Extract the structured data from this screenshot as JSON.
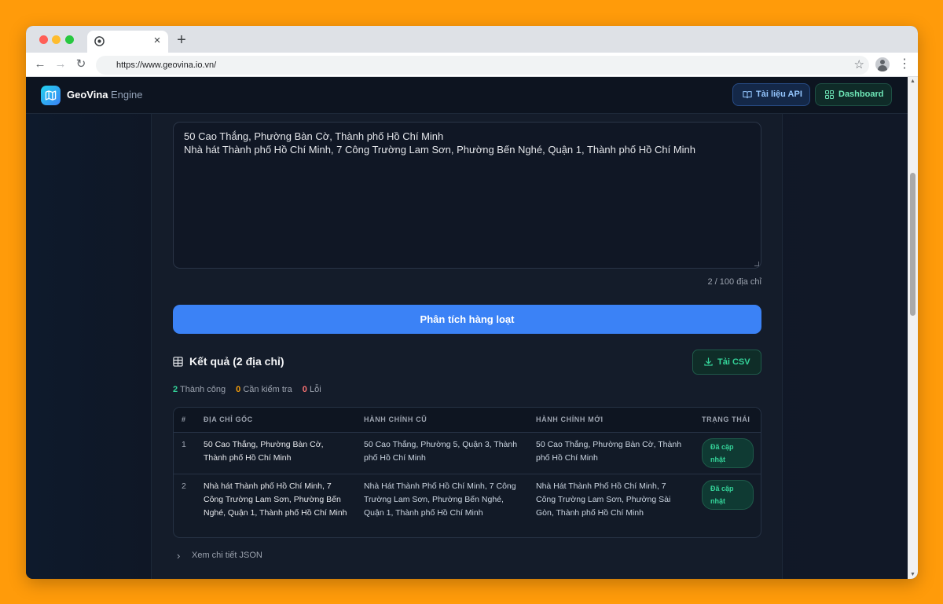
{
  "browser": {
    "url": "https://www.geovina.io.vn/",
    "new_tab": "+",
    "tab_close": "×"
  },
  "header": {
    "brand_name": "GeoVina",
    "brand_suffix": "Engine",
    "api_docs_label": "Tài liệu API",
    "dashboard_label": "Dashboard"
  },
  "input": {
    "lines": [
      "50 Cao Thắng, Phường Bàn Cờ, Thành phố Hồ Chí Minh",
      "Nhà hát Thành phố Hồ Chí Minh, 7 Công Trường Lam Sơn, Phường Bến Nghé, Quận 1, Thành phố Hồ Chí Minh"
    ],
    "counter": "2 / 100 địa chỉ"
  },
  "actions": {
    "analyze_label": "Phân tích hàng loạt",
    "csv_label": "Tải CSV"
  },
  "results": {
    "title": "Kết quả (2 địa chỉ)",
    "stats": {
      "success_count": "2",
      "success_label": "Thành công",
      "check_count": "0",
      "check_label": "Cần kiểm tra",
      "error_count": "0",
      "error_label": "Lỗi"
    },
    "columns": [
      "#",
      "ĐỊA CHỈ GỐC",
      "HÀNH CHÍNH CŨ",
      "HÀNH CHÍNH MỚI",
      "TRẠNG THÁI"
    ],
    "rows": [
      {
        "index": "1",
        "original": "50 Cao Thắng, Phường Bàn Cờ, Thành phố Hồ Chí Minh",
        "old_admin": "50 Cao Thắng, Phường 5, Quận 3, Thành phố Hồ Chí Minh",
        "new_admin": "50 Cao Thắng, Phường Bàn Cờ, Thành phố Hồ Chí Minh",
        "status": "Đã cập nhật"
      },
      {
        "index": "2",
        "original": "Nhà hát Thành phố Hồ Chí Minh, 7 Công Trường Lam Sơn, Phường Bến Nghé, Quận 1, Thành phố Hồ Chí Minh",
        "old_admin": "Nhà Hát Thành Phố Hồ Chí Minh, 7 Công Trường Lam Sơn, Phường Bến Nghé, Quận 1, Thành phố Hồ Chí Minh",
        "new_admin": "Nhà Hát Thành Phố Hồ Chí Minh, 7 Công Trường Lam Sơn, Phường Sài Gòn, Thành phố Hồ Chí Minh",
        "status": "Đã cập nhật"
      }
    ],
    "json_toggle_label": "Xem chi tiết JSON"
  },
  "colors": {
    "accent_blue": "#3b82f6",
    "success_green": "#34d399",
    "warning_amber": "#f59e0b",
    "error_red": "#f87171",
    "page_background": "#FF9B0A"
  }
}
